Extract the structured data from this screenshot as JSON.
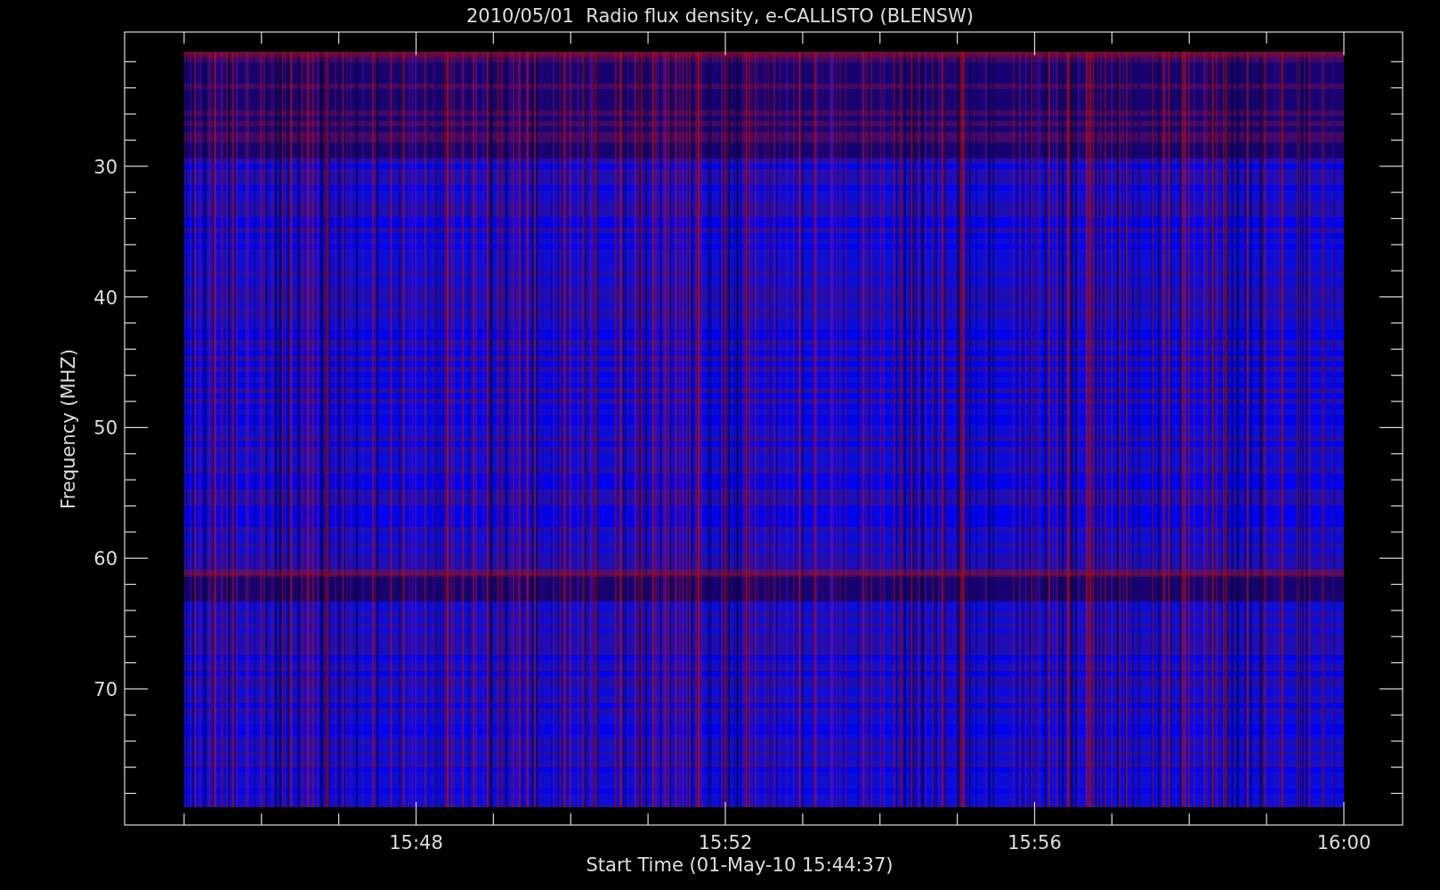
{
  "title": "2010/05/01  Radio flux density, e-CALLISTO (BLENSW)",
  "y_axis": {
    "label": "Frequency (MHZ)",
    "ticks": [
      "30",
      "40",
      "50",
      "60",
      "70"
    ]
  },
  "x_axis": {
    "label": "Start Time (01-May-10 15:44:37)",
    "ticks": [
      "15:48",
      "15:52",
      "15:56",
      "16:00"
    ]
  }
}
